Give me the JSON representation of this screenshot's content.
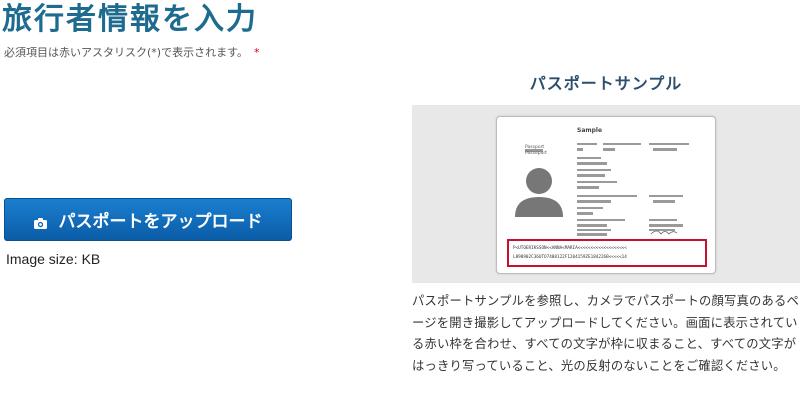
{
  "page": {
    "title": "旅行者情報を入力",
    "required_note": "必須項目は赤いアスタリスク(*)で表示されます。",
    "required_star": "*"
  },
  "upload": {
    "button_label": "パスポートをアップロード",
    "icon": "camera-icon",
    "image_size_label": "Image size:",
    "image_size_value": "KB"
  },
  "sample": {
    "title": "パスポートサンプル",
    "card": {
      "heading": "Sample",
      "doc_type": "Passport",
      "doc_type_alt": "Passeport",
      "mrz_line1": "P<UTOERIKSSON<<ANNA<MARIA<<<<<<<<<<<<<<<<<<<",
      "mrz_line2": "L898902C36UTO7408122F1204159ZE184226B<<<<<14"
    },
    "description": "パスポートサンプルを参照し、カメラでパスポートの顔写真のあるページを開き撮影してアップロードしてください。画面に表示されている赤い枠を合わせ、すべての文字が枠に収まること、すべての文字がはっきり写っていること、光の反射のないことをご確認ください。"
  },
  "colors": {
    "title": "#1d6b8f",
    "button": "#0b5ca6",
    "required_star": "#d0021b",
    "frame_highlight": "#c8102e"
  }
}
